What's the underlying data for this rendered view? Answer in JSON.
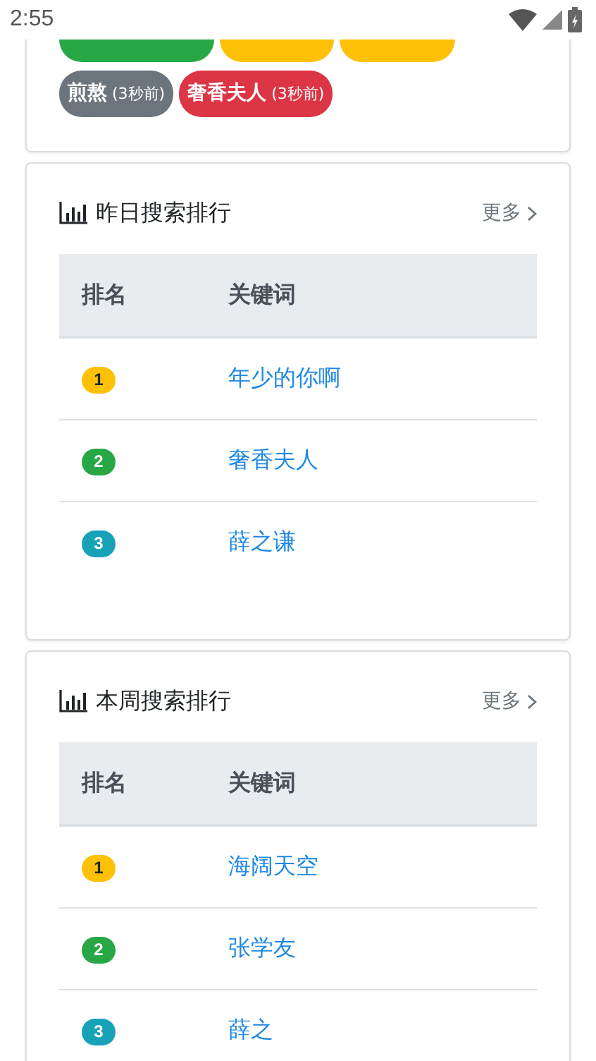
{
  "status_bar": {
    "time": "2:55"
  },
  "hot_tags": [
    {
      "kind": "cut",
      "color": "#28a745"
    },
    {
      "kind": "cut",
      "color": "#ffc107"
    },
    {
      "kind": "cut",
      "color": "#ffc107"
    },
    {
      "kind": "full",
      "label": "煎熬",
      "time": "(3秒前)",
      "color": "#6c757d"
    },
    {
      "kind": "full",
      "label": "奢香夫人",
      "time": "(3秒前)",
      "color": "#dc3545"
    }
  ],
  "rankings": [
    {
      "title": "昨日搜索排行",
      "more": "更多",
      "columns": [
        "排名",
        "关键词"
      ],
      "rows": [
        {
          "rank": "1",
          "color": "#ffc107",
          "keyword": "年少的你啊"
        },
        {
          "rank": "2",
          "color": "#28a745",
          "keyword": "奢香夫人"
        },
        {
          "rank": "3",
          "color": "#17a2b8",
          "keyword": "薛之谦"
        }
      ]
    },
    {
      "title": "本周搜索排行",
      "more": "更多",
      "columns": [
        "排名",
        "关键词"
      ],
      "rows": [
        {
          "rank": "1",
          "color": "#ffc107",
          "keyword": "海阔天空"
        },
        {
          "rank": "2",
          "color": "#28a745",
          "keyword": "张学友"
        },
        {
          "rank": "3",
          "color": "#17a2b8",
          "keyword": "薛之"
        }
      ]
    }
  ]
}
